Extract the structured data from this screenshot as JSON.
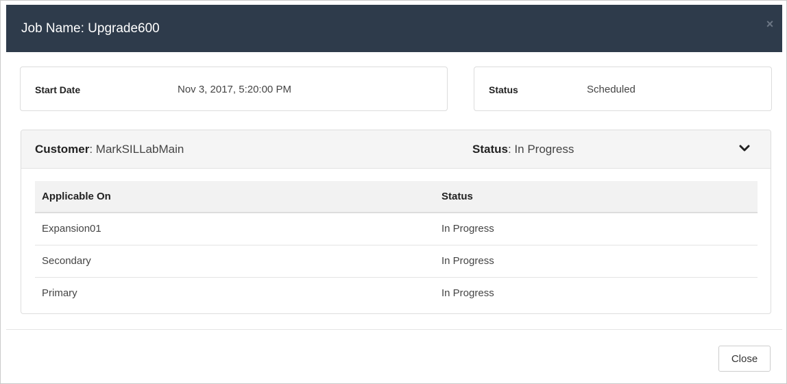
{
  "modal": {
    "title": "Job Name: Upgrade600",
    "close_icon_glyph": "×"
  },
  "job_info": {
    "start_date_label": "Start Date",
    "start_date_value": "Nov 3, 2017, 5:20:00 PM",
    "status_label": "Status",
    "status_value": "Scheduled"
  },
  "customer_panel": {
    "customer_label": "Customer",
    "customer_value": ": MarkSILLabMain",
    "status_label": "Status",
    "status_value": ": In Progress",
    "expand_icon": "chevron-down-icon"
  },
  "table": {
    "headers": [
      "Applicable On",
      "Status"
    ],
    "rows": [
      [
        "Expansion01",
        "In Progress"
      ],
      [
        "Secondary",
        "In Progress"
      ],
      [
        "Primary",
        "In Progress"
      ]
    ]
  },
  "footer": {
    "close_label": "Close"
  },
  "colors": {
    "header_bg": "#2e3b4b",
    "panel_heading_bg": "#f5f5f5",
    "table_header_bg": "#f2f2f2"
  }
}
